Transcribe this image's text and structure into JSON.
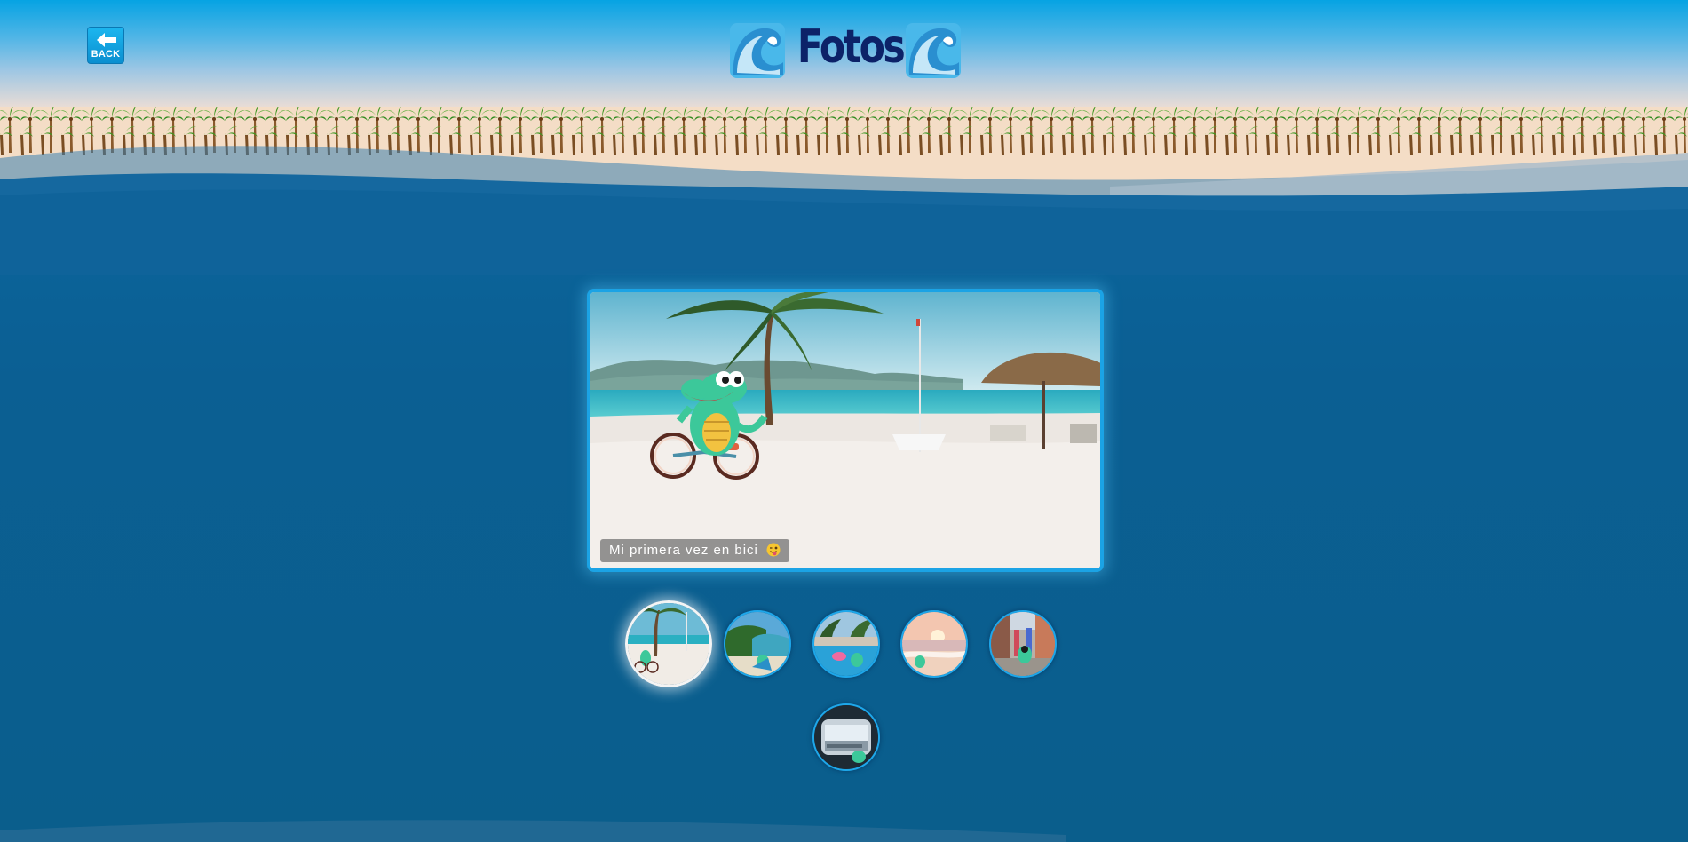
{
  "header": {
    "back_label": "BACK",
    "title": "Fotos",
    "title_icon": "ocean-wave-icon"
  },
  "viewer": {
    "caption": "Mi primera vez en bici",
    "caption_emoji": "winking-tongue-emoji"
  },
  "thumbnails": [
    {
      "subject": "beach-bike",
      "active": true
    },
    {
      "subject": "jungle-beach",
      "active": false
    },
    {
      "subject": "hotel-pool",
      "active": false
    },
    {
      "subject": "sunset-shore",
      "active": false
    },
    {
      "subject": "city-street",
      "active": false
    },
    {
      "subject": "airplane-window",
      "active": false
    }
  ],
  "colors": {
    "ocean": "#0b5f93",
    "sand": "#f4ddc6",
    "sky": "#06a3e3",
    "accent_border": "#1ba3e5",
    "title": "#0c2268",
    "crocodile": "#3cc89a"
  }
}
